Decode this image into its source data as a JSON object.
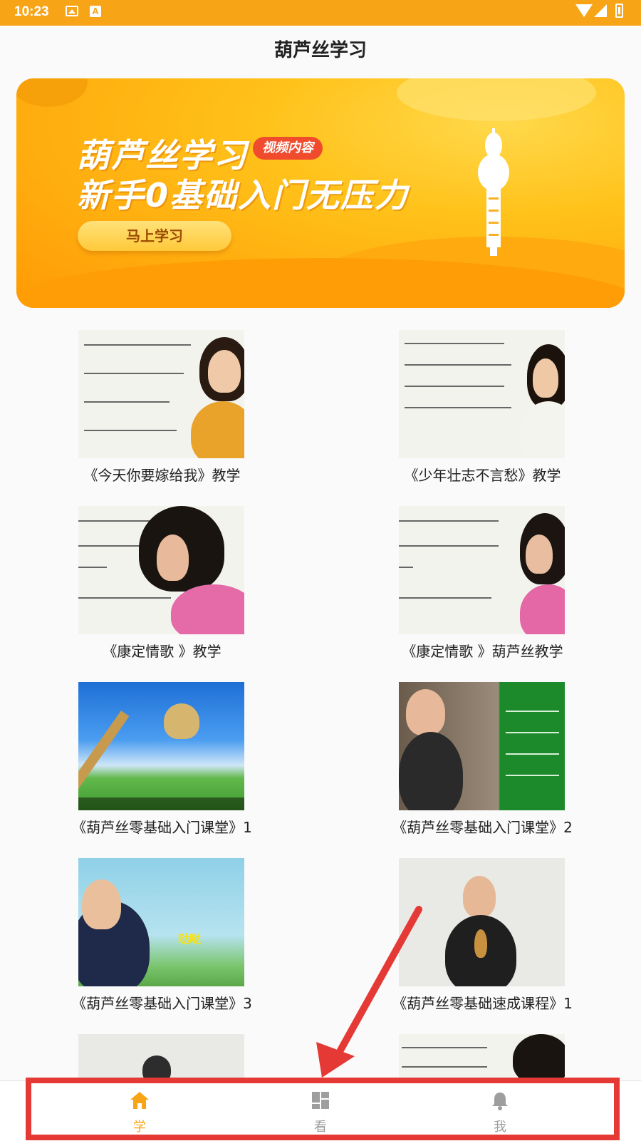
{
  "status_bar": {
    "time": "10:23"
  },
  "header": {
    "title": "葫芦丝学习"
  },
  "banner": {
    "title_line1": "葫芦丝学习",
    "tag": "视频内容",
    "title_line2": "新手0基础入门无压力",
    "button_label": "马上学习"
  },
  "videos": [
    {
      "caption": "《今天你要嫁给我》教学"
    },
    {
      "caption": "《少年壮志不言愁》教学"
    },
    {
      "caption": "《康定情歌 》教学"
    },
    {
      "caption": "《康定情歌 》葫芦丝教学"
    },
    {
      "caption": "《葫芦丝零基础入门课堂》1"
    },
    {
      "caption": "《葫芦丝零基础入门课堂》2"
    },
    {
      "caption": "《葫芦丝零基础入门课堂》3"
    },
    {
      "caption": "《葫芦丝零基础速成课程》1"
    }
  ],
  "bottom_nav": {
    "items": [
      {
        "label": "学",
        "icon": "home-icon",
        "active": true
      },
      {
        "label": "看",
        "icon": "dashboard-icon",
        "active": false
      },
      {
        "label": "我",
        "icon": "bell-icon",
        "active": false
      }
    ],
    "active_color": "#f8a417",
    "inactive_color": "#9e9e9e"
  },
  "colors": {
    "status_bar": "#f8a417",
    "annotation": "#e53935"
  }
}
